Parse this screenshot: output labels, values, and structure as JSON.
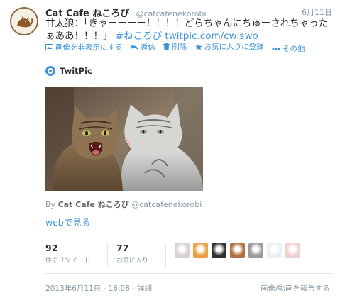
{
  "tweet": {
    "fullname": "Cat Cafe ねころび",
    "username": "@catcafenekorobi",
    "time": "6月11日",
    "text_main": "甘太狼：「きゃーーーー！！！！どらちゃんにちゅーされちゃったぁああ！！！」",
    "hashtag": "#ねころび",
    "link": "twitpic.com/cwlswo"
  },
  "actions": {
    "hide_media": "画像を非表示にする",
    "reply": "返信",
    "delete": "削除",
    "favorite": "お気に入りに登録",
    "more": "その他"
  },
  "media": {
    "provider": "TwitPic",
    "by_prefix": "By",
    "by_name": "Cat Cafe ねころび",
    "by_username": "@catcafenekorobi",
    "web_link": "webで見る"
  },
  "stats": {
    "retweets_count": "92",
    "retweets_label": "件のリツイート",
    "favorites_count": "77",
    "favorites_label": "お気に入り",
    "faces": [
      "#d8d0d8",
      "#e8a040",
      "#303030",
      "#b07040",
      "#9a9a9a",
      "#e8f0f8",
      "#f0d0d0"
    ]
  },
  "footer": {
    "timestamp": "2013年6月11日 - 16:08",
    "separator": "·",
    "details": "詳細",
    "report": "画像/動画を報告する"
  },
  "colors": {
    "link": "#3b94d9",
    "meta": "#8899a6",
    "text": "#292f33"
  }
}
